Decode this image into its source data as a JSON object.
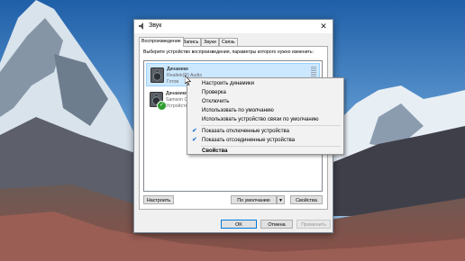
{
  "window": {
    "title": "Звук",
    "close_label": "✕"
  },
  "tabs": [
    {
      "label": "Воспроизведение"
    },
    {
      "label": "Запись"
    },
    {
      "label": "Звуки"
    },
    {
      "label": "Связь"
    }
  ],
  "instruction": "Выберите устройство воспроизведения, параметры которого нужно изменить:",
  "devices": [
    {
      "name": "Динамики",
      "driver": "Realtek(R) Audio",
      "status": "Готов",
      "icon": "speaker-icon"
    },
    {
      "name": "Динамики",
      "driver": "Samson C",
      "status": "Устройств",
      "icon": "speaker-icon",
      "badge": "✓"
    }
  ],
  "buttons": {
    "configure": "Настроить",
    "set_default": "По умолчанию",
    "properties": "Свойства",
    "ok": "OK",
    "cancel": "Отмена",
    "apply": "Применить"
  },
  "context_menu": [
    {
      "label": "Настроить динамики"
    },
    {
      "label": "Проверка"
    },
    {
      "label": "Отключить"
    },
    {
      "label": "Использовать по умолчанию"
    },
    {
      "label": "Использовать устройство связи по умолчанию"
    },
    {
      "label": "Показать отключенные устройства",
      "checked": true
    },
    {
      "label": "Показать отсоединенные устройства",
      "checked": true
    },
    {
      "label": "Свойства",
      "bold": true
    }
  ],
  "colors": {
    "selection": "#cce8ff",
    "accent": "#0078d7",
    "check": "#2c9d2c"
  }
}
